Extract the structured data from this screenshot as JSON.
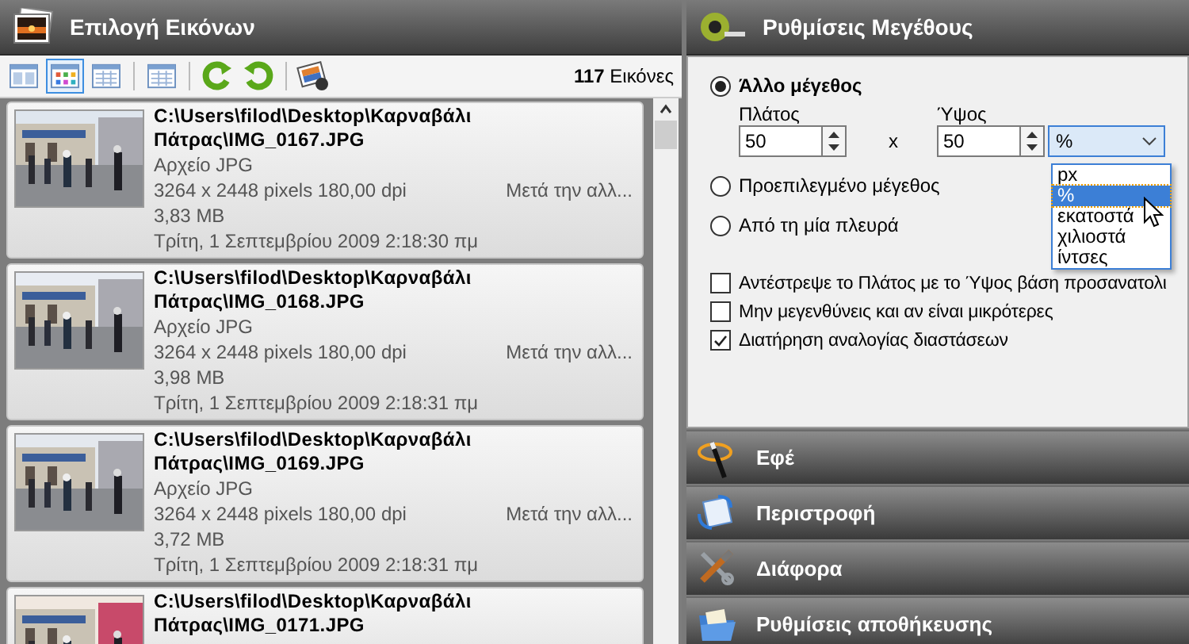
{
  "image_panel": {
    "title": "Επιλογή Εικόνων",
    "view_buttons": [
      {
        "selected": false
      },
      {
        "selected": true
      },
      {
        "selected": false
      },
      {
        "selected": false
      }
    ],
    "image_count": "**117** Εικόνες",
    "images": [
      {
        "path": "C:\\Users\\filod\\Desktop\\Καρναβάλι Πάτρας\\IMG_0167.JPG",
        "type": "Αρχείο JPG",
        "dimensions": "3264 x 2448 pixels 180,00 dpi",
        "action": "Μετά την αλλ...",
        "size": "3,83 MB",
        "date": "Τρίτη, 1 Σεπτεμβρίου 2009 2:18:30 πμ"
      },
      {
        "path": "C:\\Users\\filod\\Desktop\\Καρναβάλι Πάτρας\\IMG_0168.JPG",
        "type": "Αρχείο JPG",
        "dimensions": "3264 x 2448 pixels 180,00 dpi",
        "action": "Μετά την αλλ...",
        "size": "3,98 MB",
        "date": "Τρίτη, 1 Σεπτεμβρίου 2009 2:18:31 πμ"
      },
      {
        "path": "C:\\Users\\filod\\Desktop\\Καρναβάλι Πάτρας\\IMG_0169.JPG",
        "type": "Αρχείο JPG",
        "dimensions": "3264 x 2448 pixels 180,00 dpi",
        "action": "Μετά την αλλ...",
        "size": "3,72 MB",
        "date": "Τρίτη, 1 Σεπτεμβρίου 2009 2:18:31 πμ"
      },
      {
        "path": "C:\\Users\\filod\\Desktop\\Καρναβάλι Πάτρας\\IMG_0171.JPG"
      }
    ]
  },
  "size_panel": {
    "title": "Ρυθμίσεις Μεγέθους",
    "options": [
      {
        "label": "Άλλο μέγεθος",
        "selected": true
      },
      {
        "label": "Προεπιλεγμένο μέγεθος",
        "selected": false
      },
      {
        "label": "Από τη μία πλευρά",
        "selected": false
      }
    ],
    "width_label": "Πλάτος",
    "height_label": "Ύψος",
    "width_value": "50",
    "height_value": "50",
    "separator": "x",
    "unit": "%",
    "unit_options": [
      {
        "label": "px",
        "selected": false
      },
      {
        "label": "%",
        "selected": true
      },
      {
        "label": "εκατοστά",
        "selected": false
      },
      {
        "label": "χιλιοστά",
        "selected": false
      },
      {
        "label": "ίντσες",
        "selected": false
      }
    ],
    "checkboxes": [
      {
        "label": "Αντέστρεψε το Πλάτος με το Ύψος βάση προσανατολι",
        "checked": false
      },
      {
        "label": "Μην μεγενθύνεις και αν είναι μικρότερες",
        "checked": false
      },
      {
        "label": "Διατήρηση αναλογίας διαστάσεων",
        "checked": true
      }
    ]
  },
  "sections": [
    {
      "title": "Εφέ"
    },
    {
      "title": "Περιστροφή"
    },
    {
      "title": "Διάφορα"
    },
    {
      "title": "Ρυθμίσεις αποθήκευσης"
    }
  ]
}
